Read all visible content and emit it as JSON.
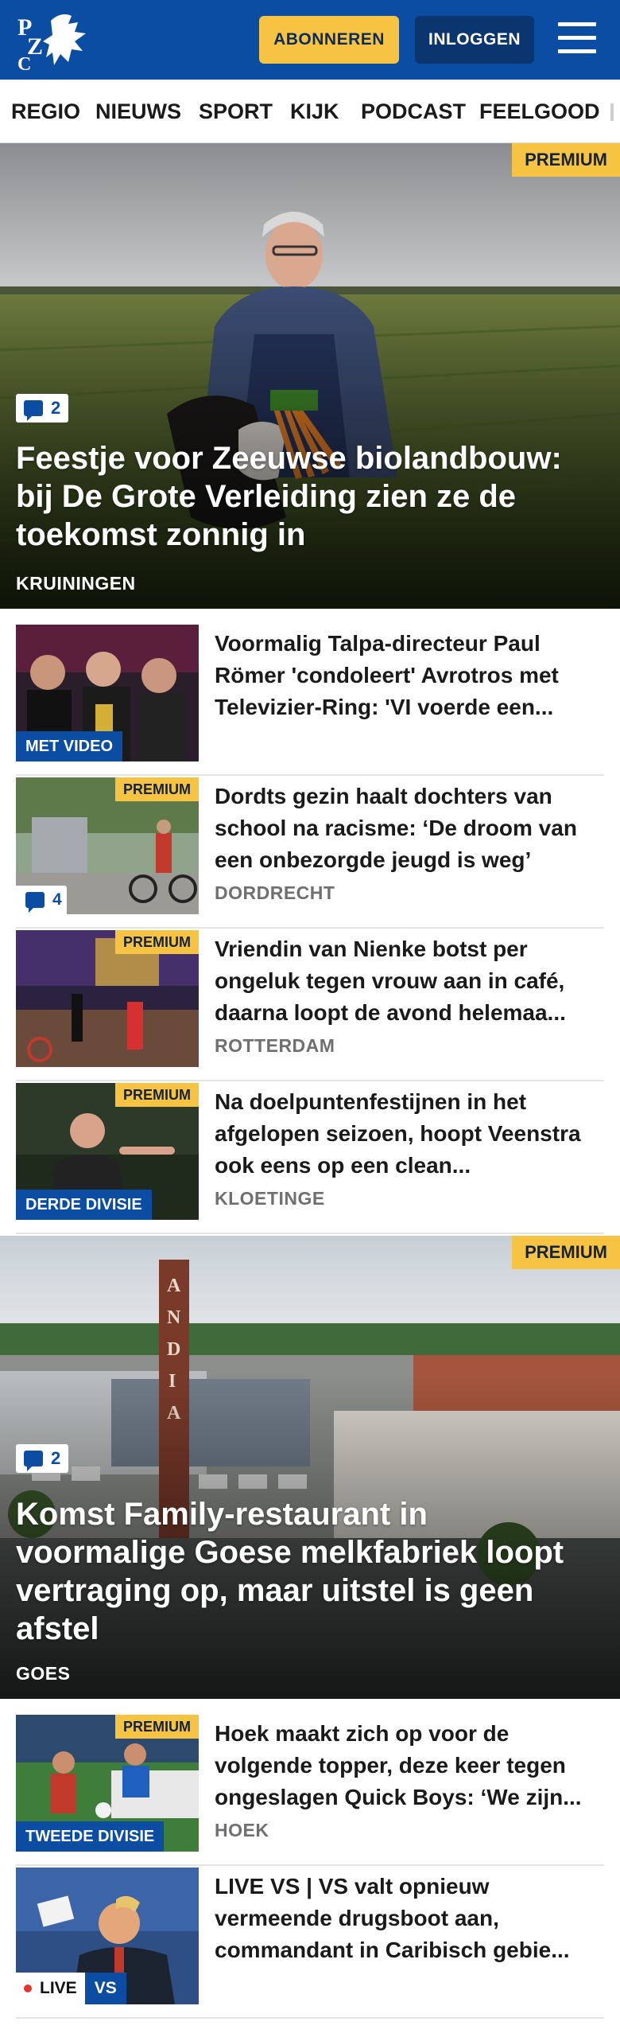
{
  "header": {
    "logo_text": "PZC",
    "subscribe_label": "ABONNEREN",
    "login_label": "INLOGGEN",
    "menu_icon": "hamburger-menu-icon",
    "background_color": "#0b4da2",
    "accent_color": "#f6c342"
  },
  "nav": {
    "items": [
      "REGIO",
      "NIEUWS",
      "SPORT",
      "KIJK",
      "PODCAST",
      "FEELGOOD"
    ]
  },
  "hero1": {
    "badge": "PREMIUM",
    "comments": "2",
    "title": "Feestje voor Zeeuwse biolandbouw: bij De Grote Verleiding zien ze de toekomst zonnig in",
    "location": "KRUININGEN"
  },
  "articles": [
    {
      "title": "Voormalig Talpa-directeur Paul Römer 'condoleert' Avrotros met Televizier-Ring: 'VI voerde een...",
      "label": "MET VIDEO"
    },
    {
      "badge": "PREMIUM",
      "comments": "4",
      "title": "Dordts gezin haalt dochters van school na racisme: ‘De droom van een onbezorgde jeugd is weg’",
      "location": "DORDRECHT"
    },
    {
      "badge": "PREMIUM",
      "title": "Vriendin van Nienke botst per ongeluk tegen vrouw aan in café, daarna loopt de avond helemaa...",
      "location": "ROTTERDAM"
    },
    {
      "badge": "PREMIUM",
      "label": "DERDE DIVISIE",
      "title": "Na doelpuntenfestijnen in het afgelopen seizoen, hoopt Veenstra ook eens op een clean...",
      "location": "KLOETINGE"
    }
  ],
  "hero2": {
    "badge": "PREMIUM",
    "comments": "2",
    "title": "Komst Family-restaurant in voormalige Goese melkfabriek loopt vertraging op, maar uitstel is geen afstel",
    "location": "GOES"
  },
  "articles2": [
    {
      "badge": "PREMIUM",
      "label": "TWEEDE DIVISIE",
      "title": "Hoek maakt zich op voor de volgende topper, deze keer tegen ongeslagen Quick Boys: ‘We zijn...",
      "location": "HOEK"
    },
    {
      "live_label": "LIVE",
      "live_tag": "VS",
      "title": "LIVE VS | VS valt opnieuw vermeende drugsboot aan, commandant in Caribisch gebie..."
    }
  ]
}
